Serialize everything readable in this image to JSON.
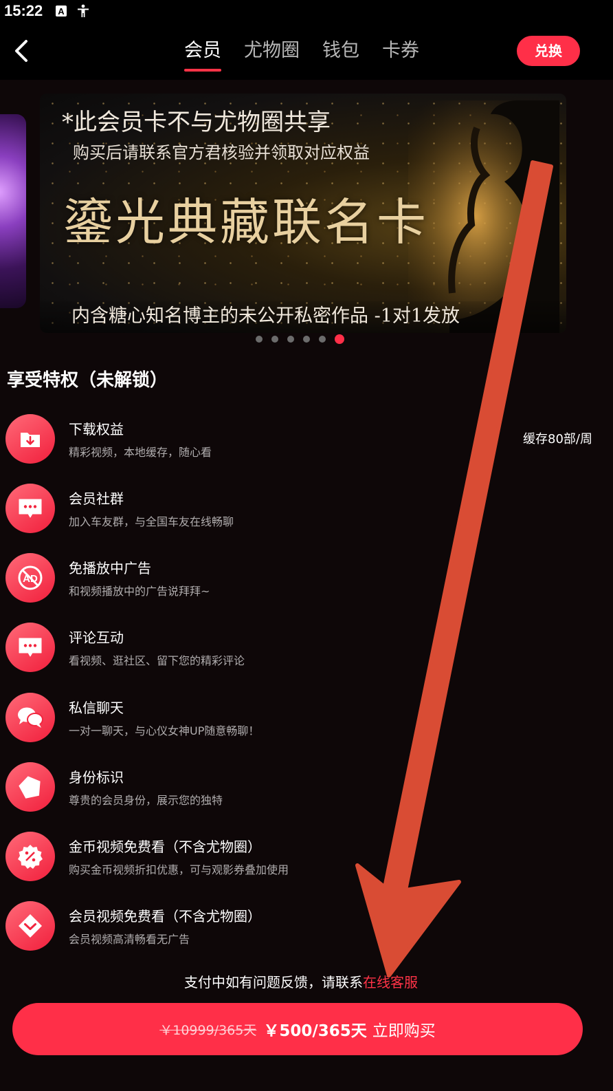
{
  "status_bar": {
    "time": "15:22",
    "icons": [
      "keyboard-a-icon",
      "accessibility-icon"
    ]
  },
  "nav": {
    "back_icon": "chevron-left-icon",
    "tabs": [
      {
        "label": "会员",
        "active": true
      },
      {
        "label": "尤物圈",
        "active": false
      },
      {
        "label": "钱包",
        "active": false
      },
      {
        "label": "卡券",
        "active": false
      }
    ],
    "redeem_label": "兑换"
  },
  "banner": {
    "line1": "*此会员卡不与尤物圈共享",
    "line2": "购买后请联系官方君核验并领取对应权益",
    "line3": "鎏光典藏联名卡",
    "line4": "内含糖心知名博主的未公开私密作品 -1对1发放",
    "dots_total": 6,
    "active_dot": 6
  },
  "privileges": {
    "title": "享受特权（未解锁）",
    "items": [
      {
        "icon": "download-folder-icon",
        "title": "下载权益",
        "subtitle": "精彩视频，本地缓存，随心看",
        "right": "缓存80部/周"
      },
      {
        "icon": "chat-bubble-icon",
        "title": "会员社群",
        "subtitle": "加入车友群，与全国车友在线畅聊"
      },
      {
        "icon": "no-ads-icon",
        "title": "免播放中广告",
        "subtitle": "和视频播放中的广告说拜拜~"
      },
      {
        "icon": "comment-icon",
        "title": "评论互动",
        "subtitle": "看视频、逛社区、留下您的精彩评论"
      },
      {
        "icon": "private-chat-icon",
        "title": "私信聊天",
        "subtitle": "一对一聊天，与心仪女神UP随意畅聊！"
      },
      {
        "icon": "identity-badge-icon",
        "title": "身份标识",
        "subtitle": "尊贵的会员身份，展示您的独特"
      },
      {
        "icon": "discount-coin-icon",
        "title": "金币视频免费看（不含尤物圈）",
        "subtitle": "购买金币视频折扣优惠，可与观影券叠加使用"
      },
      {
        "icon": "vip-diamond-icon",
        "title": "会员视频免费看（不含尤物圈）",
        "subtitle": "会员视频高清畅看无广告"
      }
    ]
  },
  "help": {
    "text": "支付中如有问题反馈，请联系",
    "link": "在线客服"
  },
  "purchase": {
    "old_price": "￥10999/365天",
    "new_price": "￥500/365天",
    "cta": "立即购买"
  },
  "colors": {
    "accent": "#ff2f48",
    "background": "#0e0708",
    "annotation_arrow": "#d94c34"
  }
}
